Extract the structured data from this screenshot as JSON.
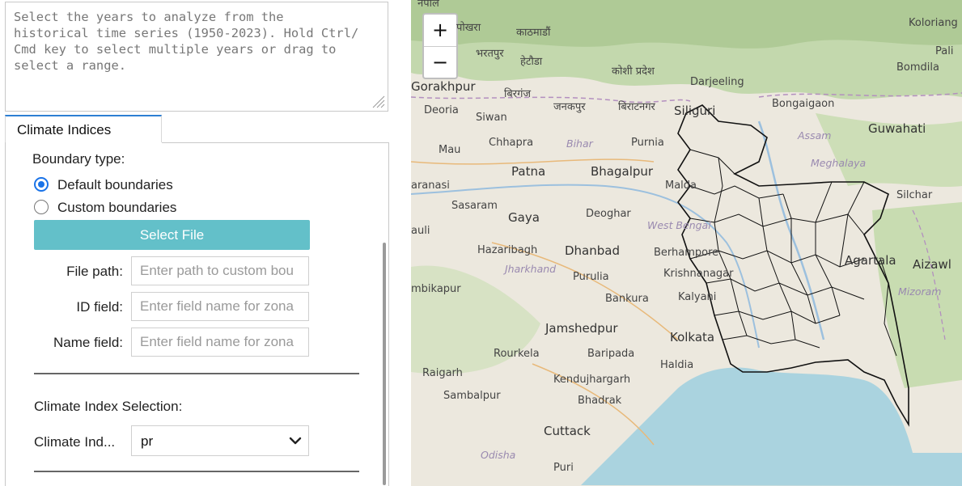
{
  "left_panel": {
    "description": "Select the years to analyze from the\nhistorical time series (1950-2023). Hold Ctrl/\nCmd key to select multiple years or drag to\nselect a range.",
    "tab_label": "Climate Indices",
    "boundary_type_label": "Boundary type:",
    "radio_default": "Default boundaries",
    "radio_custom": "Custom boundaries",
    "select_file_button": "Select File",
    "file_path_label": "File path:",
    "file_path_placeholder": "Enter path to custom bou",
    "id_field_label": "ID field:",
    "id_field_placeholder": "Enter field name for zona",
    "name_field_label": "Name field:",
    "name_field_placeholder": "Enter field name for zona",
    "climate_index_section_label": "Climate Index Selection:",
    "climate_index_label": "Climate Ind...",
    "climate_index_value": "pr"
  },
  "map": {
    "zoom_in": "+",
    "zoom_out": "−",
    "places": [
      {
        "name": "नेपाल",
        "id": "nepal"
      },
      {
        "name": "पोखरा",
        "id": "pokhara"
      },
      {
        "name": "काठमाडौं",
        "id": "kathmandu"
      },
      {
        "name": "भरतपुर",
        "id": "bharatpur"
      },
      {
        "name": "हेटौडा",
        "id": "hetauda"
      },
      {
        "name": "कोशी प्रदेश",
        "id": "koshi"
      },
      {
        "name": "Gorakhpur",
        "id": "gorakhpur"
      },
      {
        "name": "बिरगंज",
        "id": "birgunj"
      },
      {
        "name": "Darjeeling",
        "id": "darjeeling"
      },
      {
        "name": "Deoria",
        "id": "deoria"
      },
      {
        "name": "जनकपुर",
        "id": "janakpur"
      },
      {
        "name": "बिराटनगर",
        "id": "biratnagar"
      },
      {
        "name": "Siliguri",
        "id": "siliguri"
      },
      {
        "name": "Siwan",
        "id": "siwan"
      },
      {
        "name": "Bongaigaon",
        "id": "bongaigaon"
      },
      {
        "name": "Guwahati",
        "id": "guwahati"
      },
      {
        "name": "Mau",
        "id": "mau"
      },
      {
        "name": "Chhapra",
        "id": "chhapra"
      },
      {
        "name": "Bihar",
        "id": "bihar"
      },
      {
        "name": "Purnia",
        "id": "purnia"
      },
      {
        "name": "Assam",
        "id": "assam"
      },
      {
        "name": "Patna",
        "id": "patna"
      },
      {
        "name": "Bhagalpur",
        "id": "bhagalpur"
      },
      {
        "name": "Meghalaya",
        "id": "meghalaya"
      },
      {
        "name": "aranasi",
        "id": "varanasi"
      },
      {
        "name": "Malda",
        "id": "malda"
      },
      {
        "name": "Silchar",
        "id": "silchar"
      },
      {
        "name": "Sasaram",
        "id": "sasaram"
      },
      {
        "name": "Gaya",
        "id": "gaya"
      },
      {
        "name": "Deoghar",
        "id": "deoghar"
      },
      {
        "name": "West Bengal",
        "id": "westbengal"
      },
      {
        "name": "auli",
        "id": "auli"
      },
      {
        "name": "Hazaribagh",
        "id": "hazaribagh"
      },
      {
        "name": "Dhanbad",
        "id": "dhanbad"
      },
      {
        "name": "Berhampore",
        "id": "berhampore"
      },
      {
        "name": "Agartala",
        "id": "agartala"
      },
      {
        "name": "Aizawl",
        "id": "aizawl"
      },
      {
        "name": "Jharkhand",
        "id": "jharkhand"
      },
      {
        "name": "Purulia",
        "id": "purulia"
      },
      {
        "name": "Krishnanagar",
        "id": "krishnanagar"
      },
      {
        "name": "Mizoram",
        "id": "mizoram"
      },
      {
        "name": "mbikapur",
        "id": "ambikapur"
      },
      {
        "name": "Bankura",
        "id": "bankura"
      },
      {
        "name": "Kalyani",
        "id": "kalyani"
      },
      {
        "name": "Jamshedpur",
        "id": "jamshedpur"
      },
      {
        "name": "Kolkata",
        "id": "kolkata"
      },
      {
        "name": "Rourkela",
        "id": "rourkela"
      },
      {
        "name": "Baripada",
        "id": "baripada"
      },
      {
        "name": "Haldia",
        "id": "haldia"
      },
      {
        "name": "Raigarh",
        "id": "raigarh"
      },
      {
        "name": "Kendujhargarh",
        "id": "kendujhargarh"
      },
      {
        "name": "Sambalpur",
        "id": "sambalpur"
      },
      {
        "name": "Bhadrak",
        "id": "bhadrak"
      },
      {
        "name": "Cuttack",
        "id": "cuttack"
      },
      {
        "name": "Odisha",
        "id": "odisha"
      },
      {
        "name": "Puri",
        "id": "puri"
      },
      {
        "name": "Koloriang",
        "id": "koloriang"
      },
      {
        "name": "Pali",
        "id": "pali"
      },
      {
        "name": "Bomdila",
        "id": "bomdila"
      }
    ]
  }
}
